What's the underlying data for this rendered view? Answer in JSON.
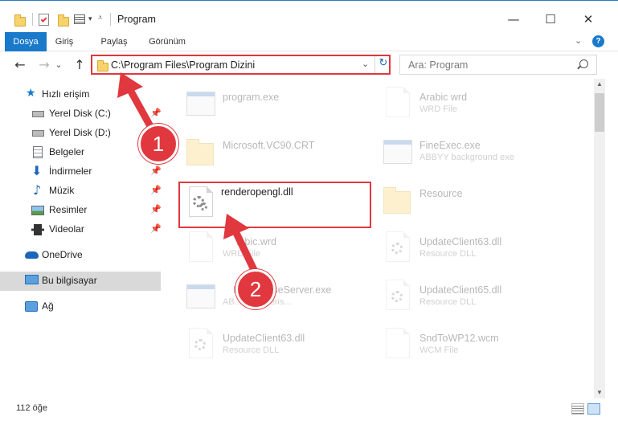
{
  "window": {
    "title": "Program",
    "minimize_glyph": "—",
    "maximize_glyph": "☐",
    "close_glyph": "✕"
  },
  "ribbon": {
    "tabs": [
      "Dosya",
      "Giriş",
      "Paylaş",
      "Görünüm"
    ],
    "expand_glyph": "⌄",
    "help_glyph": "?"
  },
  "nav": {
    "back_glyph": "←",
    "forward_glyph": "→",
    "recent_glyph": "⌄",
    "up_glyph": "↑",
    "address": "C:\\Program Files\\Program Dizini",
    "address_chevron": "⌄",
    "refresh_glyph": "↻",
    "search_placeholder": "Ara: Program"
  },
  "sidebar": {
    "quick_access": "Hızlı erişim",
    "items": [
      {
        "label": "Yerel Disk (C:)",
        "icon": "drive-icon",
        "pinned": true
      },
      {
        "label": "Yerel Disk (D:)",
        "icon": "drive-icon",
        "pinned": false
      },
      {
        "label": "Belgeler",
        "icon": "documents-icon",
        "pinned": true
      },
      {
        "label": "İndirmeler",
        "icon": "download-icon",
        "pinned": true
      },
      {
        "label": "Müzik",
        "icon": "music-icon",
        "pinned": true
      },
      {
        "label": "Resimler",
        "icon": "pictures-icon",
        "pinned": true
      },
      {
        "label": "Videolar",
        "icon": "videos-icon",
        "pinned": true
      }
    ],
    "onedrive": "OneDrive",
    "this_pc": "Bu bilgisayar",
    "network": "Ağ",
    "pin_glyph": "📌"
  },
  "files": [
    {
      "name": "program.exe",
      "sub": "",
      "type": "exe"
    },
    {
      "name": "Arabic wrd",
      "sub": "WRD File",
      "type": "doc"
    },
    {
      "name": "Microsoft.VC90.CRT",
      "sub": "",
      "type": "folder"
    },
    {
      "name": "FineExec.exe",
      "sub": "ABBYY background exe",
      "type": "exe"
    },
    {
      "name": "renderopengl.dll",
      "sub": "",
      "type": "dll"
    },
    {
      "name": "Resource",
      "sub": "",
      "type": "folder"
    },
    {
      "name": "...bic.wrd",
      "sub": "WRD File",
      "type": "doc"
    },
    {
      "name": "UpdateClient63.dll",
      "sub": "Resource DLL",
      "type": "dll"
    },
    {
      "name": "N...LicenseServer.exe",
      "sub": "AB...soft Licens...",
      "type": "exe"
    },
    {
      "name": "UpdateClient65.dll",
      "sub": "Resource DLL",
      "type": "dll"
    },
    {
      "name": "UpdateClient63.dll",
      "sub": "Resource DLL",
      "type": "dll"
    },
    {
      "name": "SndToWP12.wcm",
      "sub": "WCM File",
      "type": "doc"
    }
  ],
  "status": {
    "item_count": "112 öğe"
  },
  "annotations": {
    "step1": "1",
    "step2": "2"
  },
  "colors": {
    "accent": "#1979ca",
    "highlight": "#e0383e"
  }
}
